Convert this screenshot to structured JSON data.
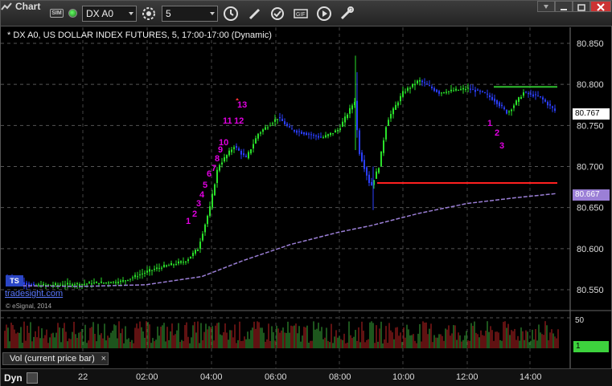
{
  "toolbar": {
    "app_title": "Chart",
    "sim_badge": "SIM",
    "symbol": "DX A0",
    "interval": "5",
    "icons": [
      "chart-icon",
      "sim-badge",
      "connection-dot",
      "settings-gear-icon",
      "clock-icon",
      "pencil-icon",
      "refresh-icon",
      "gif-icon",
      "play-icon",
      "tools-icon"
    ]
  },
  "chart": {
    "title": "* DX A0, US DOLLAR INDEX FUTURES, 5, 17:00-17:00 (Dynamic)",
    "watermark": "© eSignal, 2014",
    "brand_logo": "TS",
    "brand_name": "tradesight.com",
    "last_price": "80.767",
    "ma_price": "80.667",
    "price_ticks": [
      "80.850",
      "80.800",
      "80.750",
      "80.700",
      "80.650",
      "80.600",
      "80.550"
    ],
    "colors": {
      "up": "#2ae02a",
      "down": "#2b3fff",
      "ma": "#9b7fd6",
      "red_line": "#ff2020",
      "green_line": "#2fbf2f",
      "count_magenta": "#e000e0",
      "count_green": "#2da02d"
    },
    "magenta_counts": [
      "1",
      "2",
      "3",
      "4",
      "5",
      "6",
      "7",
      "8",
      "9",
      "10",
      "11",
      "12",
      "13"
    ],
    "right_counts": [
      "1",
      "2",
      "3"
    ]
  },
  "volume": {
    "label": "Vol (current price bar)",
    "close": "×",
    "max": "50",
    "current": "1"
  },
  "xaxis": {
    "mode": "Dyn",
    "ticks": [
      "22",
      "02:00",
      "04:00",
      "06:00",
      "08:00",
      "10:00",
      "12:00",
      "14:00"
    ]
  }
}
